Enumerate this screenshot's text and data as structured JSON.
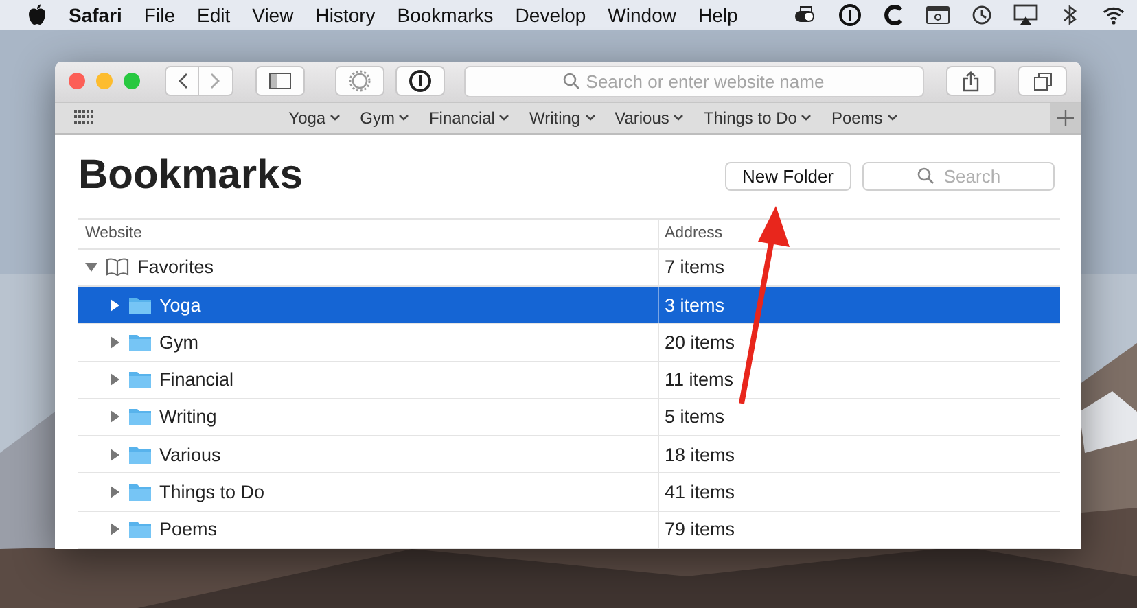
{
  "menu_bar": {
    "items": [
      {
        "label": "Safari",
        "kind": "app"
      },
      {
        "label": "File",
        "kind": "menu"
      },
      {
        "label": "Edit",
        "kind": "menu"
      },
      {
        "label": "View",
        "kind": "menu"
      },
      {
        "label": "History",
        "kind": "menu"
      },
      {
        "label": "Bookmarks",
        "kind": "menu"
      },
      {
        "label": "Develop",
        "kind": "menu"
      },
      {
        "label": "Window",
        "kind": "menu"
      },
      {
        "label": "Help",
        "kind": "menu"
      }
    ]
  },
  "toolbar": {
    "address_field": {
      "placeholder": "Search or enter website name"
    }
  },
  "favorites_bar": {
    "items": [
      {
        "label": "Yoga"
      },
      {
        "label": "Gym"
      },
      {
        "label": "Financial"
      },
      {
        "label": "Writing"
      },
      {
        "label": "Various"
      },
      {
        "label": "Things to Do"
      },
      {
        "label": "Poems"
      }
    ]
  },
  "bookmarks": {
    "title": "Bookmarks",
    "new_folder_button": "New Folder",
    "search": {
      "placeholder": "Search"
    },
    "table": {
      "columns": [
        "Website",
        "Address"
      ],
      "rows": [
        {
          "name": "Favorites",
          "address": "7 items",
          "kind": "favorites",
          "expanded": true,
          "selected": false,
          "children": [
            {
              "name": "Yoga",
              "address": "3 items",
              "kind": "folder",
              "expanded": false,
              "selected": true
            },
            {
              "name": "Gym",
              "address": "20 items",
              "kind": "folder",
              "expanded": false,
              "selected": false
            },
            {
              "name": "Financial",
              "address": "11 items",
              "kind": "folder",
              "expanded": false,
              "selected": false
            },
            {
              "name": "Writing",
              "address": "5 items",
              "kind": "folder",
              "expanded": false,
              "selected": false
            },
            {
              "name": "Various",
              "address": "18 items",
              "kind": "folder",
              "expanded": false,
              "selected": false
            },
            {
              "name": "Things to Do",
              "address": "41 items",
              "kind": "folder",
              "expanded": false,
              "selected": false
            },
            {
              "name": "Poems",
              "address": "79 items",
              "kind": "folder",
              "expanded": false,
              "selected": false
            }
          ]
        }
      ]
    }
  }
}
